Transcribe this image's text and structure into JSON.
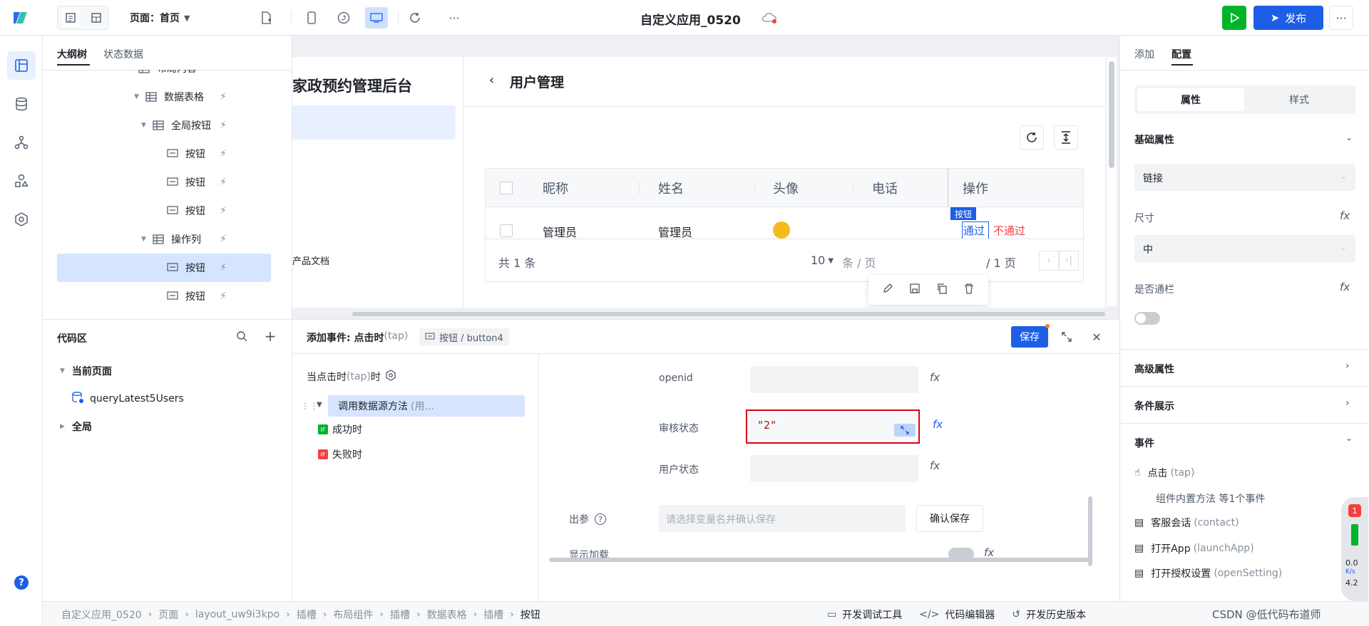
{
  "topbar": {
    "page_label": "页面：首页",
    "app_title": "自定义应用_0520",
    "publish_label": "发布"
  },
  "outline": {
    "tabs": [
      "大纲树",
      "状态数据"
    ],
    "items": [
      {
        "label": "布局内容",
        "indent": 0,
        "kind": "grid"
      },
      {
        "label": "数据表格",
        "indent": 1,
        "kind": "grid"
      },
      {
        "label": "全局按钮",
        "indent": 2,
        "kind": "grid"
      },
      {
        "label": "按钮",
        "indent": 3,
        "kind": "button"
      },
      {
        "label": "按钮",
        "indent": 3,
        "kind": "button"
      },
      {
        "label": "按钮",
        "indent": 3,
        "kind": "button"
      },
      {
        "label": "操作列",
        "indent": 2,
        "kind": "grid"
      },
      {
        "label": "按钮",
        "indent": 3,
        "kind": "button",
        "selected": true
      },
      {
        "label": "按钮",
        "indent": 3,
        "kind": "button"
      }
    ]
  },
  "code": {
    "title": "代码区",
    "current_page": "当前页面",
    "query": "queryLatest5Users",
    "global": "全局"
  },
  "canvas": {
    "app_heading": "家政预约管理后台",
    "doc_link": "产品文档",
    "page_title": "用户管理",
    "table": {
      "headers": [
        "昵称",
        "姓名",
        "头像",
        "电话",
        "操作"
      ],
      "row": [
        "管理员",
        "管理员",
        "",
        "",
        ""
      ],
      "action_pass": "通过",
      "action_fail": "不通过",
      "button_tag": "按钮"
    },
    "pagination": {
      "total": "共 1 条",
      "page_size": "10",
      "per": "条 / 页",
      "pages": "/ 1 页"
    }
  },
  "event": {
    "title": "添加事件: 点击时",
    "title_suffix": "(tap)",
    "target": "按钮 / button4",
    "save_label": "保存",
    "trigger": "当点击时",
    "trigger_suffix": "(tap)",
    "trigger_tail": "时",
    "action": "调用数据源方法",
    "action_suffix": "(用...",
    "success": "成功时",
    "failure": "失败时",
    "params": [
      {
        "label": "openid",
        "value": ""
      },
      {
        "label": "审核状态",
        "value": "\"2\""
      },
      {
        "label": "用户状态",
        "value": ""
      }
    ],
    "out_label": "出参",
    "out_placeholder": "请选择变量名并确认保存",
    "confirm_save": "确认保存",
    "show_loading": "显示加载"
  },
  "config": {
    "tabs": [
      "添加",
      "配置"
    ],
    "subtabs": [
      "属性",
      "样式"
    ],
    "basic": "基础属性",
    "link_value": "链接",
    "size_label": "尺寸",
    "size_value": "中",
    "fullwidth_label": "是否通栏",
    "advanced": "高级属性",
    "condition": "条件展示",
    "events": "事件",
    "event_list": [
      {
        "name": "点击",
        "code": "(tap)"
      },
      {
        "name": "组件内置方法 等1个事件",
        "code": ""
      },
      {
        "name": "客服会话",
        "code": "(contact)"
      },
      {
        "name": "打开App",
        "code": "(launchApp)"
      },
      {
        "name": "打开授权设置",
        "code": "(openSetting)"
      }
    ],
    "badge_count": "1",
    "speed": "0.0",
    "speed_unit": "K/s",
    "speed2": "4.2"
  },
  "statusbar": {
    "crumbs": [
      "自定义应用_0520",
      "页面",
      "layout_uw9i3kpo",
      "插槽",
      "布局组件",
      "插槽",
      "数据表格",
      "插槽",
      "按钮"
    ],
    "tools": [
      "开发调试工具",
      "代码编辑器",
      "开发历史版本"
    ],
    "watermark": "CSDN @低代码布道师"
  }
}
